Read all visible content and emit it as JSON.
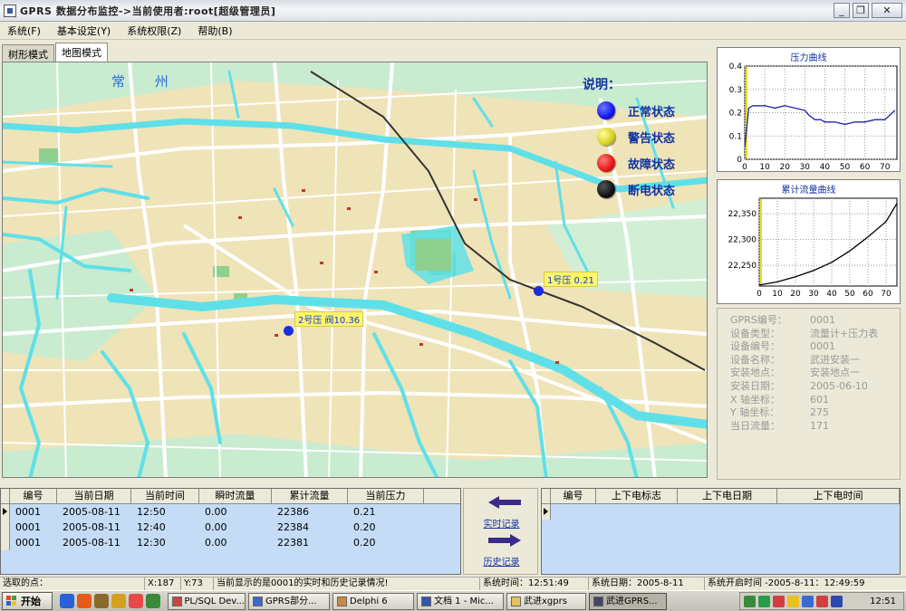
{
  "window": {
    "title": "GPRS 数据分布监控->当前使用者:root[超级管理员]"
  },
  "menu": [
    "系统(F)",
    "基本设定(Y)",
    "系统权限(Z)",
    "帮助(B)"
  ],
  "tabs": [
    {
      "label": "树形模式",
      "active": false
    },
    {
      "label": "地图模式",
      "active": true
    }
  ],
  "map": {
    "city_label": "常 州",
    "legend_title": "说明：",
    "legend": [
      {
        "label": "正常状态",
        "color": "#1515e8"
      },
      {
        "label": "警告状态",
        "color": "#d4d020"
      },
      {
        "label": "故障状态",
        "color": "#e81515"
      },
      {
        "label": "断电状态",
        "color": "#111111"
      }
    ],
    "markers": [
      {
        "label": "1号压 0.21"
      },
      {
        "label": "2号压  阀10.36"
      }
    ],
    "colors": {
      "land": "#efe3b8",
      "water": "#5fe0e8",
      "park": "#a8d9a8",
      "road": "#ffffff",
      "rail": "#333333"
    }
  },
  "pressure_chart": {
    "title": "压力曲线",
    "chart_data": {
      "type": "line",
      "title": "压力曲线",
      "x": [
        0,
        2,
        4,
        6,
        8,
        10,
        15,
        20,
        25,
        30,
        32,
        35,
        38,
        40,
        45,
        50,
        55,
        60,
        65,
        70,
        75
      ],
      "values": [
        0.05,
        0.22,
        0.23,
        0.23,
        0.23,
        0.23,
        0.22,
        0.23,
        0.22,
        0.21,
        0.19,
        0.17,
        0.17,
        0.16,
        0.16,
        0.15,
        0.16,
        0.16,
        0.17,
        0.17,
        0.21
      ],
      "xlim": [
        0,
        76
      ],
      "ylim": [
        0,
        0.4
      ],
      "xticks": [
        "0",
        "10",
        "20",
        "30",
        "40",
        "50",
        "60",
        "70"
      ],
      "yticks": [
        "0",
        "0.1",
        "0.2",
        "0.3",
        "0.4"
      ],
      "grid": true,
      "line_color": "#2222aa"
    }
  },
  "flow_chart": {
    "title": "累计流量曲线",
    "chart_data": {
      "type": "line",
      "title": "累计流量曲线",
      "x": [
        0,
        10,
        20,
        30,
        40,
        50,
        60,
        70,
        76
      ],
      "values": [
        22212,
        22218,
        22228,
        22240,
        22256,
        22278,
        22305,
        22335,
        22370
      ],
      "xlim": [
        0,
        76
      ],
      "ylim": [
        22210,
        22380
      ],
      "xticks": [
        "0",
        "10",
        "20",
        "30",
        "40",
        "50",
        "60",
        "70"
      ],
      "yticks": [
        "22,250",
        "22,300",
        "22,350"
      ],
      "grid": true,
      "line_color": "#000000"
    }
  },
  "info": [
    {
      "k": "GPRS编号：",
      "v": "0001"
    },
    {
      "k": "设备类型：",
      "v": "流量计+压力表"
    },
    {
      "k": "设备编号：",
      "v": "0001"
    },
    {
      "k": "设备名称：",
      "v": "武进安装一"
    },
    {
      "k": "安装地点：",
      "v": "安装地点一"
    },
    {
      "k": "安装日期：",
      "v": "2005-06-10"
    },
    {
      "k": "X 轴坐标：",
      "v": "601"
    },
    {
      "k": "Y 轴坐标：",
      "v": "275"
    },
    {
      "k": "当日流量：",
      "v": "171"
    }
  ],
  "records": {
    "columns": [
      "编号",
      "当前日期",
      "当前时间",
      "瞬时流量",
      "累计流量",
      "当前压力"
    ],
    "rows": [
      [
        "0001",
        "2005-08-11",
        "12:50",
        "0.00",
        "22386",
        "0.21"
      ],
      [
        "0001",
        "2005-08-11",
        "12:40",
        "0.00",
        "22384",
        "0.20"
      ],
      [
        "0001",
        "2005-08-11",
        "12:30",
        "0.00",
        "22381",
        "0.20"
      ]
    ]
  },
  "nav": {
    "realtime": "实时记录",
    "history": "历史记录"
  },
  "events": {
    "columns": [
      "编号",
      "上下电标志",
      "上下电日期",
      "上下电时间"
    ]
  },
  "status": {
    "selected": "选取的点：",
    "x": "X:187",
    "y": "Y:73",
    "msg": "当前显示的是0001的实时和历史记录情况!",
    "systime": "系统时间：12:51:49",
    "sysdate": "系统日期：2005-8-11",
    "starttime": "系统开启时间 -2005-8-11：12:49:59"
  },
  "taskbar": {
    "start": "开始",
    "tasks": [
      "PL/SQL Dev...",
      "GPRS部分...",
      "Delphi 6",
      "文档 1 - Mic...",
      "武进xgprs",
      "武进GPRS..."
    ],
    "clock": "12:51"
  }
}
